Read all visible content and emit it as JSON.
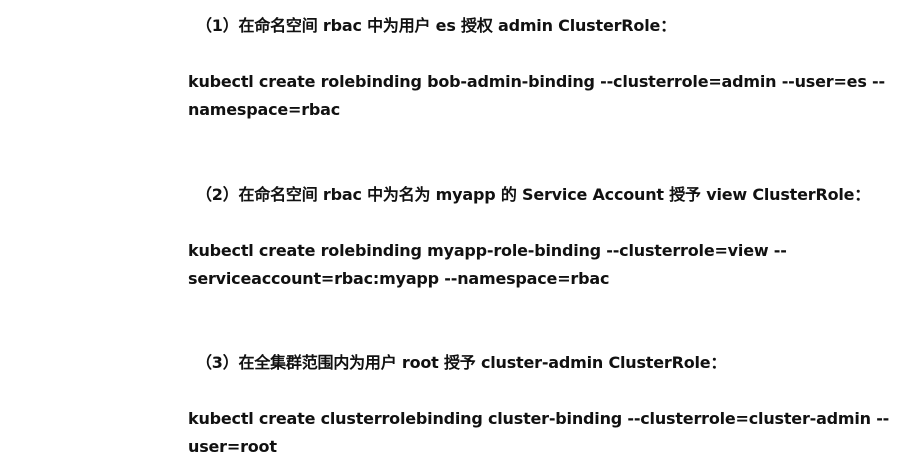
{
  "sections": [
    {
      "heading": "（1）在命名空间 rbac 中为用户 es 授权 admin ClusterRole：",
      "command_lines": [
        "kubectl create rolebinding bob-admin-binding --clusterrole=admin --user=es --",
        "namespace=rbac"
      ]
    },
    {
      "heading": "（2）在命名空间 rbac 中为名为 myapp 的 Service Account 授予 view ClusterRole：",
      "command_lines": [
        "kubectl create rolebinding myapp-role-binding --clusterrole=view --",
        "serviceaccount=rbac:myapp --namespace=rbac"
      ]
    },
    {
      "heading": "（3）在全集群范围内为用户 root 授予 cluster-admin ClusterRole：",
      "command_lines": [
        "kubectl create clusterrolebinding cluster-binding --clusterrole=cluster-admin --",
        "user=root"
      ]
    }
  ]
}
